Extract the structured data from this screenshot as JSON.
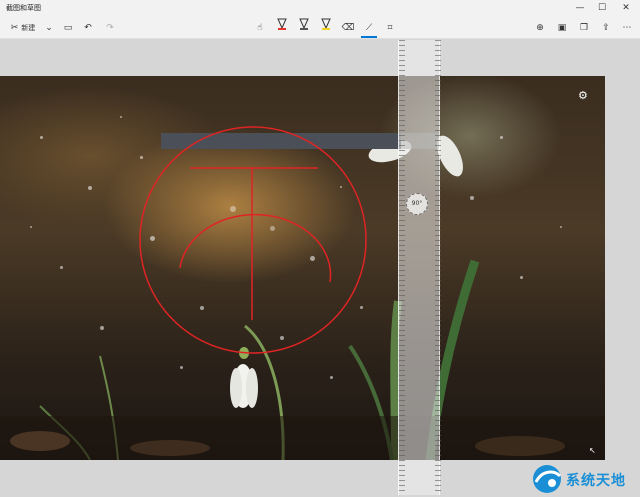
{
  "window": {
    "title": "截图和草图",
    "minimize_glyph": "—",
    "maximize_glyph": "☐",
    "close_glyph": "✕"
  },
  "toolbar": {
    "new_label": "新建",
    "new_icon": "snip-icon",
    "dropdown_icon": "chevron-down-icon",
    "open_icon": "folder-icon",
    "undo_icon": "undo-icon",
    "redo_icon": "redo-icon",
    "tools": [
      {
        "name": "touch-writing-icon",
        "glyph": "☝"
      },
      {
        "name": "ballpoint-pen-icon",
        "glyph": "▽"
      },
      {
        "name": "pencil-icon",
        "glyph": "▽"
      },
      {
        "name": "highlighter-icon",
        "glyph": "▽"
      },
      {
        "name": "eraser-icon",
        "glyph": "⌫"
      },
      {
        "name": "ruler-icon",
        "glyph": "⟋"
      },
      {
        "name": "crop-icon",
        "glyph": "⌗"
      }
    ],
    "right_tools": [
      {
        "name": "zoom-icon",
        "glyph": "⊕"
      },
      {
        "name": "save-icon",
        "glyph": "▣"
      },
      {
        "name": "copy-icon",
        "glyph": "❐"
      },
      {
        "name": "share-icon",
        "glyph": "⇪"
      },
      {
        "name": "more-icon",
        "glyph": "⋯"
      }
    ],
    "colors": {
      "pen": "#e8332a",
      "pencil": "#555555",
      "highlighter": "#f2d21c",
      "accent": "#0078d7"
    }
  },
  "ruler": {
    "angle_label": "90°"
  },
  "watermark": {
    "text": "系统天地"
  }
}
